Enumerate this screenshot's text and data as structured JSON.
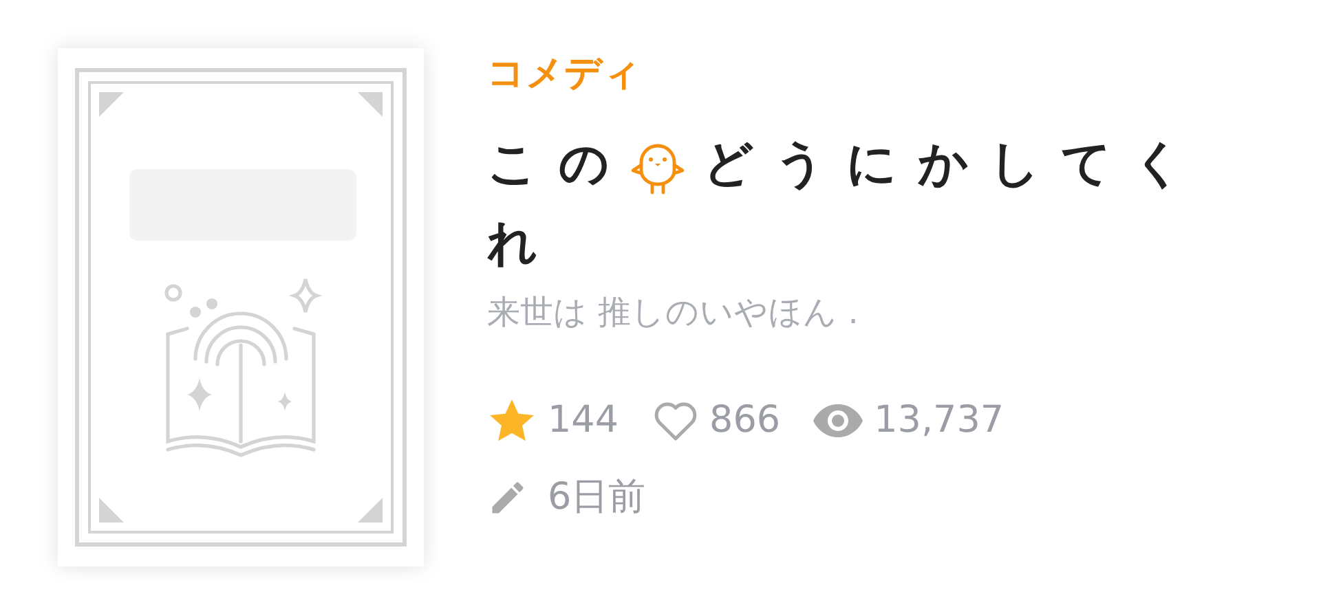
{
  "book": {
    "category": "コメディ",
    "title_start": "この",
    "title_middle": "どうにかしてく",
    "title_end": "れ",
    "author": "来世は 推しのいやほん .",
    "stats": [
      {
        "kind": "star",
        "value": "144"
      },
      {
        "kind": "heart",
        "value": "866"
      },
      {
        "kind": "eye",
        "value": "13,737"
      }
    ],
    "updated": "6日前"
  }
}
